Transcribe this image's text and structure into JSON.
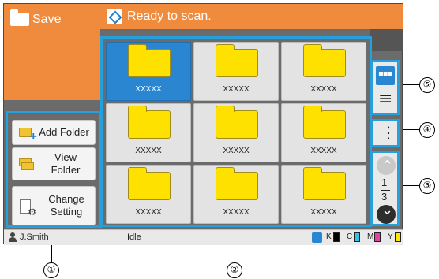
{
  "screen": {
    "title": "Save",
    "status_message": "Ready to scan."
  },
  "left_panel": {
    "add_folder": "Add Folder",
    "view_folder": "View Folder",
    "change_setting": "Change Setting"
  },
  "folders": [
    {
      "label": "XXXXX",
      "selected": true
    },
    {
      "label": "XXXXX",
      "selected": false
    },
    {
      "label": "XXXXX",
      "selected": false
    },
    {
      "label": "XXXXX",
      "selected": false
    },
    {
      "label": "XXXXX",
      "selected": false
    },
    {
      "label": "XXXXX",
      "selected": false
    },
    {
      "label": "XXXXX",
      "selected": false
    },
    {
      "label": "XXXXX",
      "selected": false
    },
    {
      "label": "XXXXX",
      "selected": false
    }
  ],
  "pagination": {
    "current": "1",
    "total": "3"
  },
  "bottom_bar": {
    "user": "J.Smith",
    "status": "Idle",
    "ink_labels": [
      "K",
      "C",
      "M",
      "Y"
    ]
  },
  "callouts": [
    "①",
    "②",
    "③",
    "④",
    "⑤"
  ],
  "colors": {
    "accent_orange": "#f08a3c",
    "highlight_blue": "#26a0dc",
    "selected_blue": "#2b86d2",
    "folder_yellow": "#ffe100"
  },
  "icons": [
    "folder-icon",
    "diamond-scan-icon",
    "add-folder-icon",
    "view-folder-icon",
    "settings-icon",
    "grid-view-icon",
    "list-view-icon",
    "more-menu-icon",
    "chevron-up-icon",
    "chevron-down-icon",
    "user-icon",
    "ink-icon"
  ]
}
